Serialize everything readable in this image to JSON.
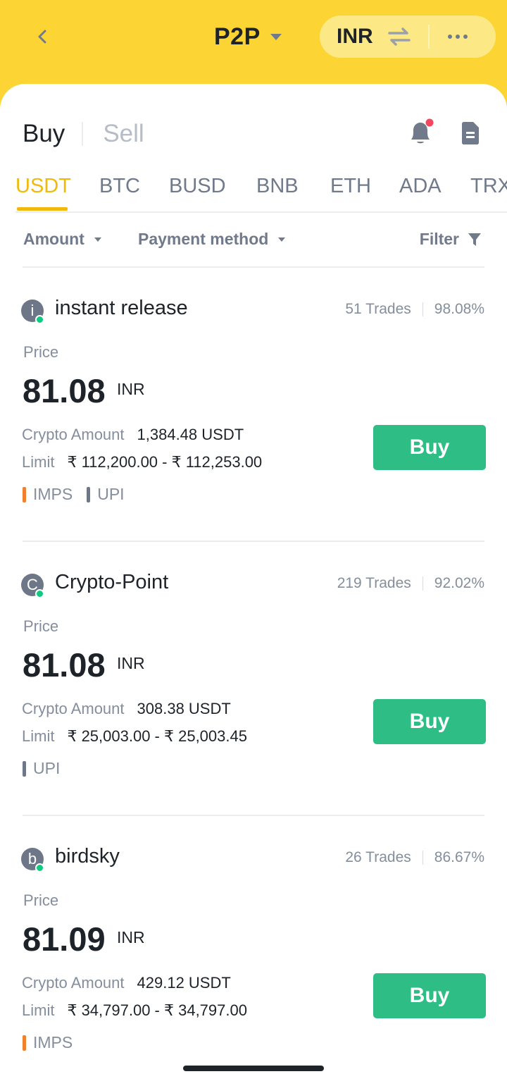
{
  "header": {
    "title": "P2P",
    "currency": "INR",
    "icons": {
      "back": "back-arrow-icon",
      "swap": "swap-arrows-icon",
      "more": "more-dots-icon",
      "title_caret": "caret-down-icon"
    }
  },
  "trade_tabs": {
    "buy": "Buy",
    "sell": "Sell",
    "active": "buy",
    "icons": [
      "bell-icon",
      "orders-icon"
    ],
    "notification_dot": true
  },
  "coins": [
    "USDT",
    "BTC",
    "BUSD",
    "BNB",
    "ETH",
    "ADA",
    "TRX"
  ],
  "active_coin": "USDT",
  "filters": {
    "amount": "Amount",
    "payment_method": "Payment method",
    "filter": "Filter"
  },
  "offers": [
    {
      "avatar": "i",
      "merchant": "instant release",
      "trades": "51 Trades",
      "completion": "98.08%",
      "price_label": "Price",
      "price": "81.08",
      "currency": "INR",
      "crypto_amount_label": "Crypto Amount",
      "crypto_amount": "1,384.48 USDT",
      "limit_label": "Limit",
      "limit": "₹ 112,200.00 - ₹ 112,253.00",
      "buy": "Buy",
      "methods": [
        {
          "name": "IMPS",
          "color": "#f0802c"
        },
        {
          "name": "UPI",
          "color": "#6e7787"
        }
      ]
    },
    {
      "avatar": "C",
      "merchant": "Crypto-Point",
      "trades": "219 Trades",
      "completion": "92.02%",
      "price_label": "Price",
      "price": "81.08",
      "currency": "INR",
      "crypto_amount_label": "Crypto Amount",
      "crypto_amount": "308.38 USDT",
      "limit_label": "Limit",
      "limit": "₹ 25,003.00 - ₹ 25,003.45",
      "buy": "Buy",
      "methods": [
        {
          "name": "UPI",
          "color": "#6e7787"
        }
      ]
    },
    {
      "avatar": "b",
      "merchant": "birdsky",
      "trades": "26 Trades",
      "completion": "86.67%",
      "price_label": "Price",
      "price": "81.09",
      "currency": "INR",
      "crypto_amount_label": "Crypto Amount",
      "crypto_amount": "429.12 USDT",
      "limit_label": "Limit",
      "limit": "₹ 34,797.00 - ₹ 34,797.00",
      "buy": "Buy",
      "methods": [
        {
          "name": "IMPS",
          "color": "#f0802c"
        }
      ]
    }
  ],
  "colors": {
    "brand_yellow": "#fcd535",
    "accent": "#f0b90b",
    "buy_green": "#2ebd85",
    "online": "#0ecb81",
    "notification": "#f6465d"
  }
}
